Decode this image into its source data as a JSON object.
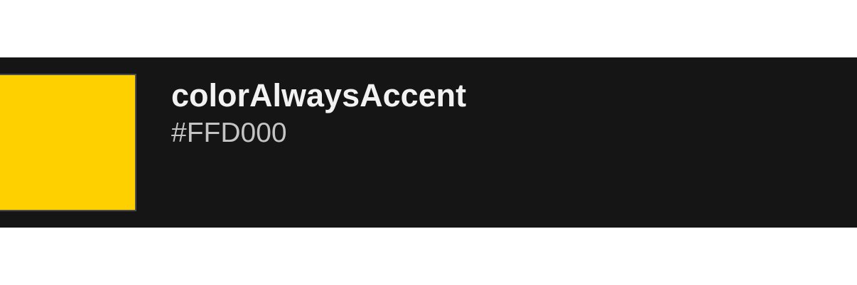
{
  "swatch": {
    "name": "colorAlwaysAccent",
    "hex": "#FFD000",
    "color": "#FFD000"
  },
  "theme": {
    "row_background": "#151515",
    "page_background": "#FFFFFF"
  }
}
